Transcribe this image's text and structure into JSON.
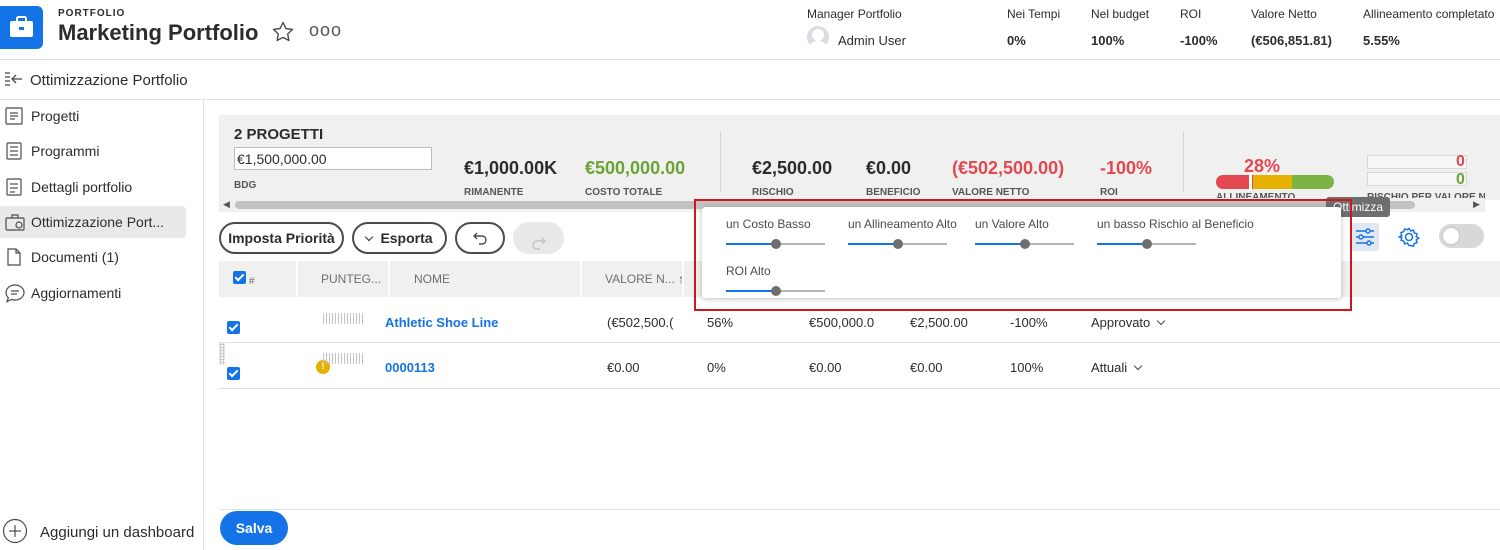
{
  "header": {
    "kicker": "PORTFOLIO",
    "title": "Marketing Portfolio",
    "more_label": "ooo",
    "metrics": [
      {
        "label": "Manager Portfolio",
        "value": "Admin User"
      },
      {
        "label": "Nei Tempi",
        "value": "0%"
      },
      {
        "label": "Nel budget",
        "value": "100%"
      },
      {
        "label": "ROI",
        "value": "-100%"
      },
      {
        "label": "Valore Netto",
        "value": "(€506,851.81)"
      },
      {
        "label": "Allineamento completato",
        "value": "5.55%"
      }
    ]
  },
  "subheader": {
    "title": "Ottimizzazione Portfolio"
  },
  "sidebar": {
    "items": [
      {
        "label": "Progetti",
        "icon": "projects-icon"
      },
      {
        "label": "Programmi",
        "icon": "programs-icon"
      },
      {
        "label": "Dettagli portfolio",
        "icon": "details-icon"
      },
      {
        "label": "Ottimizzazione Port...",
        "icon": "optimization-icon",
        "active": true
      },
      {
        "label": "Documenti (1)",
        "icon": "documents-icon"
      },
      {
        "label": "Aggiornamenti",
        "icon": "updates-icon"
      }
    ],
    "add_dashboard": "Aggiungi un dashboard"
  },
  "summary": {
    "count": "2 PROGETTI",
    "budget_value": "€1,500,000.00",
    "budget_label": "BDG",
    "remaining": {
      "value": "€1,000.00K",
      "label": "RIMANENTE"
    },
    "total_cost": {
      "value": "€500,000.00",
      "label": "COSTO TOTALE"
    },
    "risk": {
      "value": "€2,500.00",
      "label": "RISCHIO"
    },
    "benefit": {
      "value": "€0.00",
      "label": "BENEFICIO"
    },
    "net_value": {
      "value": "(€502,500.00)",
      "label": "VALORE NETTO"
    },
    "roi": {
      "value": "-100%",
      "label": "ROI"
    },
    "alignment": {
      "value": "28%",
      "label": "ALLINEAMENTO",
      "percent": 28
    },
    "risk_value": {
      "label": "RISCHIO PER VALORE N",
      "top": "0",
      "bottom": "0"
    }
  },
  "toolbar": {
    "prioritize": "Imposta Priorità",
    "export": "Esporta",
    "tooltip": "Ottimizza"
  },
  "table": {
    "headers": {
      "num": "#",
      "score": "PUNTEG...",
      "name": "NOME",
      "net_value": "VALORE N..."
    },
    "rows": [
      {
        "name": "Athletic Shoe Line",
        "net_value": "(€502,500.(",
        "alignment": "56%",
        "cost": "€500,000.0",
        "risk": "€2,500.00",
        "roi": "-100%",
        "status": "Approvato",
        "warning": false
      },
      {
        "name": "0000113",
        "net_value": "€0.00",
        "alignment": "0%",
        "cost": "€0.00",
        "risk": "€0.00",
        "roi": "100%",
        "status": "Attuali",
        "warning": true
      }
    ]
  },
  "optimize_sliders": [
    {
      "label": "un Costo Basso",
      "value": 0.5
    },
    {
      "label": "un Allineamento Alto",
      "value": 0.5
    },
    {
      "label": "un Valore Alto",
      "value": 0.5
    },
    {
      "label": "un basso Rischio al Beneficio",
      "value": 0.5
    },
    {
      "label": "ROI Alto",
      "value": 0.5
    }
  ],
  "footer": {
    "save": "Salva"
  },
  "colors": {
    "accent": "#1473e6",
    "positive": "#6aa434",
    "negative": "#e34850",
    "highlight": "#d0171d"
  }
}
